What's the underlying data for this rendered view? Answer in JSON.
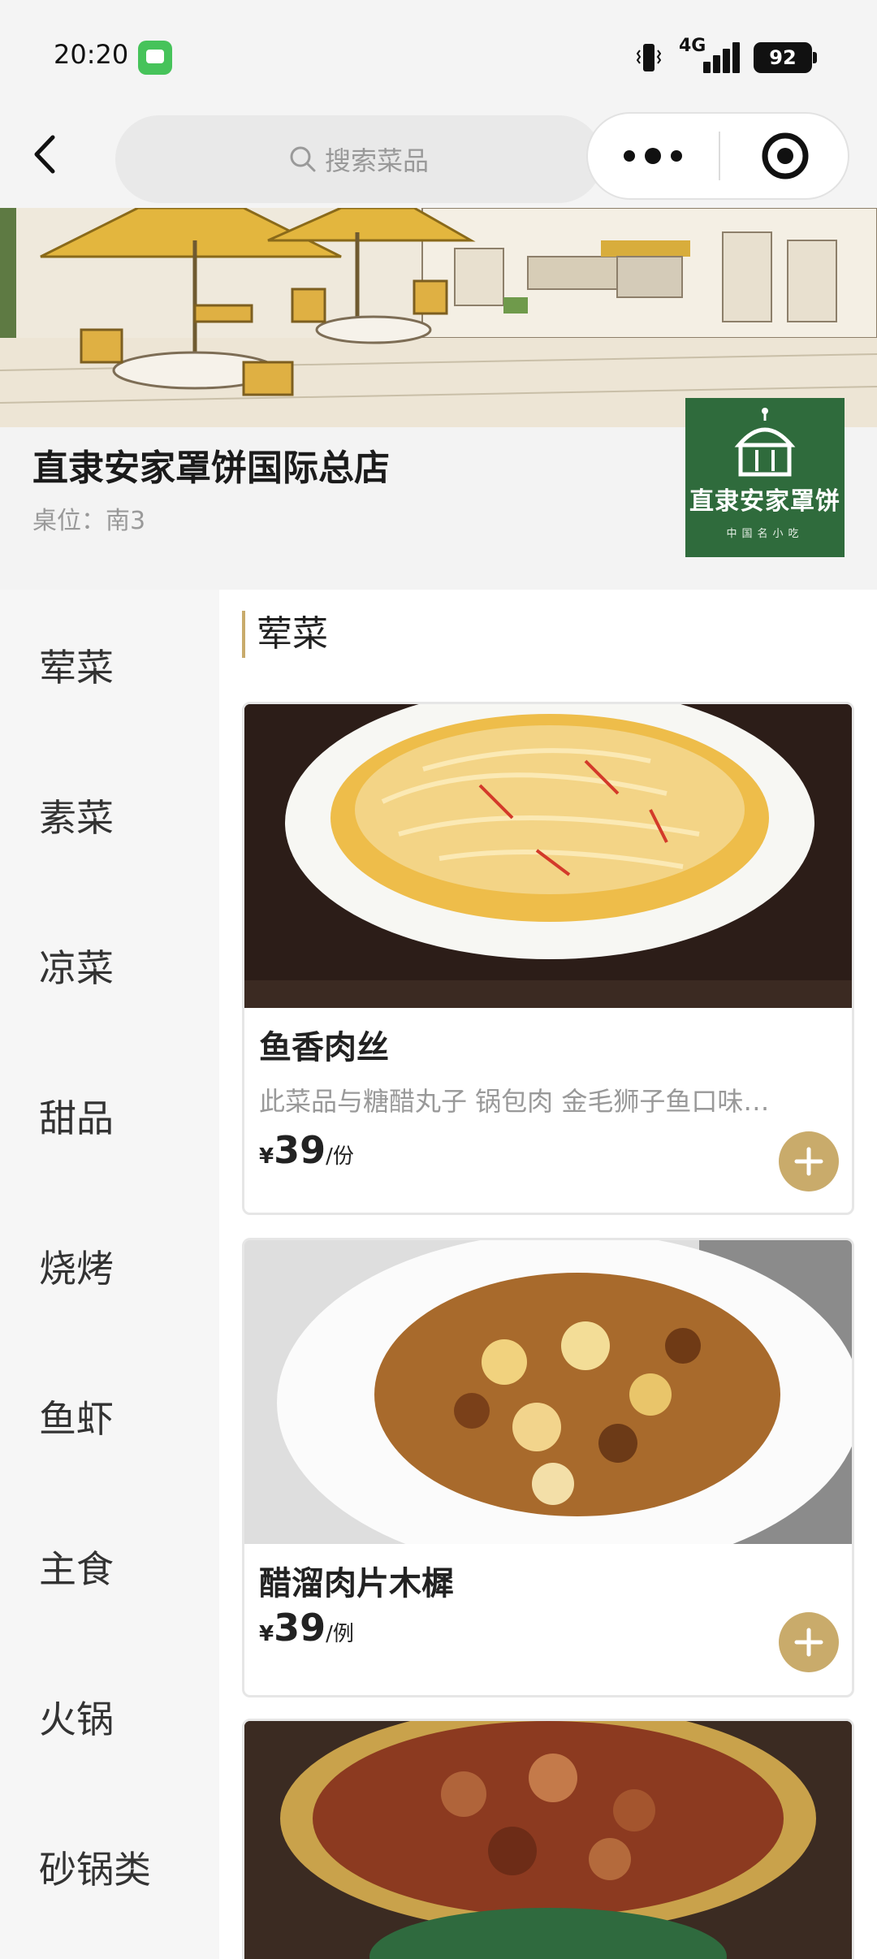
{
  "status_bar": {
    "time": "20:20",
    "network": "4G",
    "battery": "92",
    "icons": [
      "message-app-icon",
      "vibrate-icon",
      "signal-icon",
      "battery-icon"
    ]
  },
  "nav": {
    "search_placeholder": "搜索菜品",
    "icons": [
      "back-icon",
      "search-icon",
      "more-icon",
      "close-target-icon"
    ]
  },
  "store": {
    "name": "直隶安家罩饼国际总店",
    "table_info": "桌位：南3",
    "logo_text": "直隶安家罩饼",
    "logo_subtext": "中国名小吃"
  },
  "sidebar": {
    "items": [
      {
        "label": "荤菜"
      },
      {
        "label": "素菜"
      },
      {
        "label": "凉菜"
      },
      {
        "label": "甜品"
      },
      {
        "label": "烧烤"
      },
      {
        "label": "鱼虾"
      },
      {
        "label": "主食"
      },
      {
        "label": "火锅"
      },
      {
        "label": "砂锅类"
      }
    ]
  },
  "menu": {
    "section_title": "荤菜",
    "dishes": [
      {
        "name": "鱼香肉丝",
        "desc": "此菜品与糖醋丸子 锅包肉 金毛狮子鱼口味…",
        "currency": "¥",
        "price": "39",
        "unit": "/份"
      },
      {
        "name": "醋溜肉片木樨",
        "currency": "¥",
        "price": "39",
        "unit": "/例"
      }
    ]
  },
  "colors": {
    "accent": "#c9ab6b",
    "sidebar_bg": "#f6f6f6",
    "logo_green": "#2f6b3c"
  }
}
